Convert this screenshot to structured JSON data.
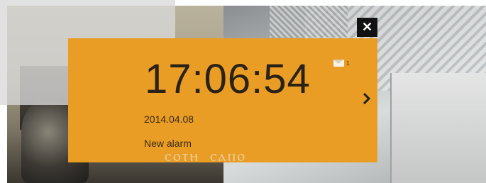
{
  "alarm": {
    "time": "17:06:54",
    "date": "2014.04.08",
    "message": "New alarm",
    "mail_count": "1"
  },
  "controls": {
    "close_label": "✕"
  },
  "camera": {
    "overlay_text": "ⲥⲟⲧⲏ ⲥⲁⲡⲟ"
  },
  "colors": {
    "card": "#ea9d24",
    "close_button": "#121212"
  },
  "icons": {
    "close": "close-icon",
    "mail": "mail-icon",
    "next": "chevron-right-icon"
  }
}
